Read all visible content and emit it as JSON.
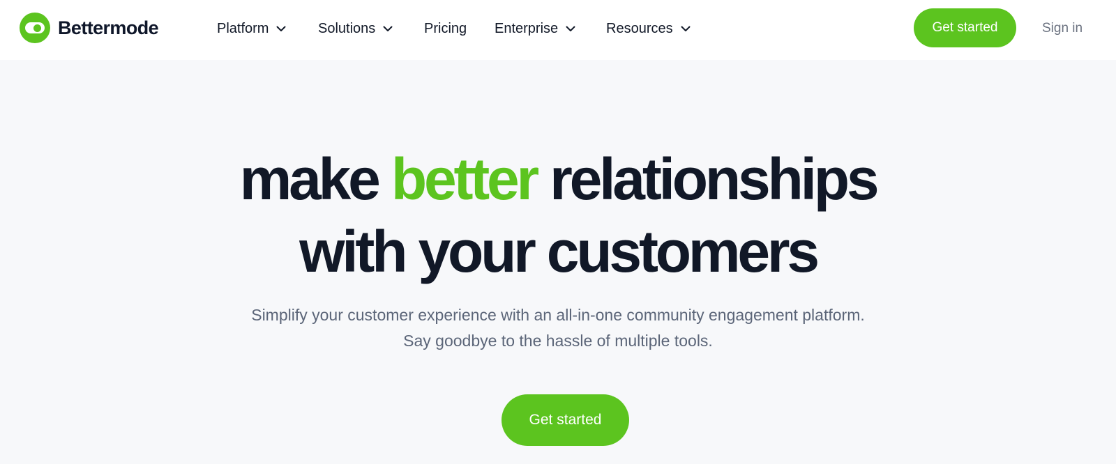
{
  "brand": {
    "name": "Bettermode",
    "logo_icon": "toggle-switch-icon",
    "accent_color": "#5cc41f"
  },
  "nav": {
    "items": [
      {
        "label": "Platform",
        "has_dropdown": true
      },
      {
        "label": "Solutions",
        "has_dropdown": true
      },
      {
        "label": "Pricing",
        "has_dropdown": false
      },
      {
        "label": "Enterprise",
        "has_dropdown": true
      },
      {
        "label": "Resources",
        "has_dropdown": true
      }
    ],
    "dropdown_icon": "chevron-down-icon"
  },
  "header_actions": {
    "get_started_label": "Get started",
    "sign_in_label": "Sign in"
  },
  "hero": {
    "title_part1": "make ",
    "title_accent": "better",
    "title_part2": " relationships",
    "title_line2": "with your customers",
    "subtitle": "Simplify your customer experience with an all-in-one community engagement platform. Say goodbye to the hassle of multiple tools.",
    "cta_label": "Get started"
  }
}
